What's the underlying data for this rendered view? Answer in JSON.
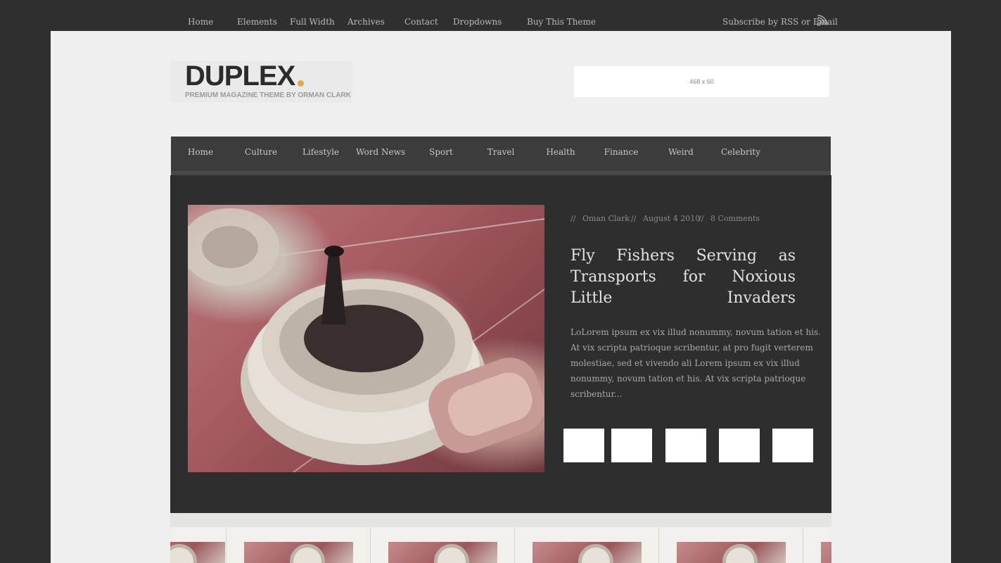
{
  "top_nav": {
    "items": [
      "Home",
      "Elements",
      "Full Width",
      "Archives",
      "Contact",
      "Dropdowns",
      "Buy This Theme"
    ],
    "subscribe": "Subscribe by RSS or Email",
    "subscribe_icon": "rss-icon"
  },
  "header": {
    "logo_text": "DUPLEX",
    "logo_dot": ".",
    "tagline": "PREMIUM MAGAZINE THEME BY ORMAN CLARK",
    "ad_label": "468 x 60"
  },
  "main_nav": {
    "items": [
      "Home",
      "Culture",
      "Lifestyle",
      "Word News",
      "Sport",
      "Travel",
      "Health",
      "Finance",
      "Weird",
      "Celebrity"
    ]
  },
  "featured": {
    "author": "Oman Clark",
    "date": "August 4 2010",
    "comments": "8 Comments",
    "separator": "//",
    "title": "Fly Fishers Serving as Transports for Noxious Little Invaders",
    "excerpt": "LoLorem ipsum ex vix illud nonummy, novum tation et his. At vix scripta patrioque scribentur, at pro fugit verterem molestiae, sed et vivendo ali Lorem ipsum ex vix illud nonummy, novum tation et his. At vix scripta patrioque scribentur...",
    "image_alt": "fly fishing reel"
  },
  "colors": {
    "outer_bg": "#2e2f2e",
    "page_bg": "#efefef",
    "featured_bg": "#2d2e2d",
    "nav_bg": "#3b3c3b",
    "logo_dot": "#e8a64a"
  }
}
